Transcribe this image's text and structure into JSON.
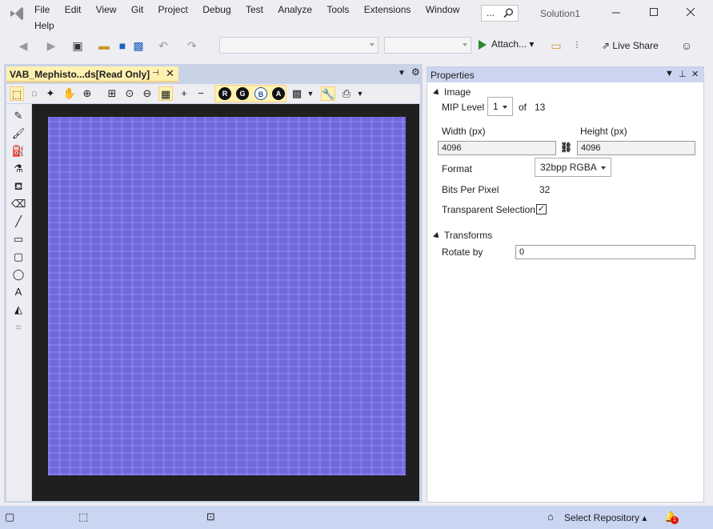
{
  "menu": [
    "File",
    "Edit",
    "View",
    "Git",
    "Project",
    "Debug",
    "Test",
    "Analyze",
    "Tools",
    "Extensions",
    "Window"
  ],
  "menu_help": "Help",
  "search": {
    "text": "..."
  },
  "solution_name": "Solution1",
  "toolbar": {
    "attach_label": "Attach...",
    "live_share_label": "Live Share"
  },
  "document": {
    "tab_title": "VAB_Mephisto...ds[Read Only]"
  },
  "channel_buttons": [
    "R",
    "G",
    "B",
    "A"
  ],
  "properties": {
    "title": "Properties",
    "image_section": "Image",
    "mip_label": "MIP Level",
    "mip_value": "1",
    "of_label": "of",
    "mip_total": "13",
    "width_label": "Width (px)",
    "width_value": "4096",
    "height_label": "Height (px)",
    "height_value": "4096",
    "format_label": "Format",
    "format_value": "32bpp RGBA",
    "bpp_label": "Bits Per Pixel",
    "bpp_value": "32",
    "transparent_label": "Transparent Selection",
    "transparent_checked": true,
    "transforms_section": "Transforms",
    "rotate_label": "Rotate by",
    "rotate_value": "0"
  },
  "status": {
    "repo_label": "Select Repository",
    "notif_count": "1"
  },
  "colors": {
    "accent": "#007acc",
    "texture": "#7f78f3",
    "tab_active": "#fff1b0"
  }
}
